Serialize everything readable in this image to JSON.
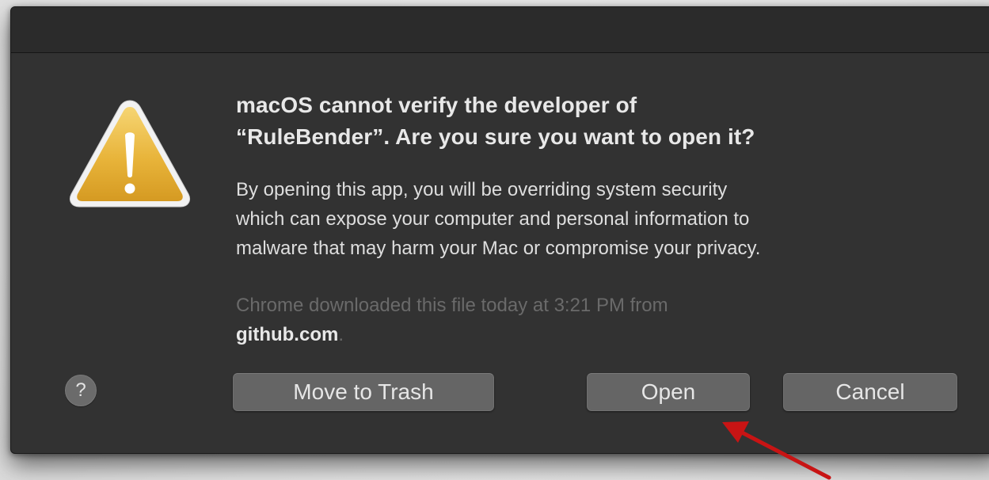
{
  "dialog": {
    "headline_lines": [
      "macOS cannot verify the developer of",
      "“RuleBender”. Are you sure you want to open it?"
    ],
    "body_lines": [
      "By opening this app, you will be overriding system security",
      "which can expose your computer and personal information to",
      "malware that may harm your Mac or compromise your privacy."
    ],
    "source_note": {
      "line1": "Chrome downloaded this file today at 3:21 PM from",
      "domain": "github.com",
      "trailing": "."
    },
    "help_label": "?",
    "buttons": {
      "move_to_trash": "Move to Trash",
      "open": "Open",
      "cancel": "Cancel"
    },
    "icons": {
      "caution": "caution-triangle-icon",
      "help": "question-mark-icon"
    }
  },
  "annotation": {
    "arrow_color": "#c81414",
    "points_to": "open-button"
  },
  "colors": {
    "dialog_bg": "#323232",
    "button_bg": "#656565",
    "warning_yellow": "#e9b73c"
  }
}
